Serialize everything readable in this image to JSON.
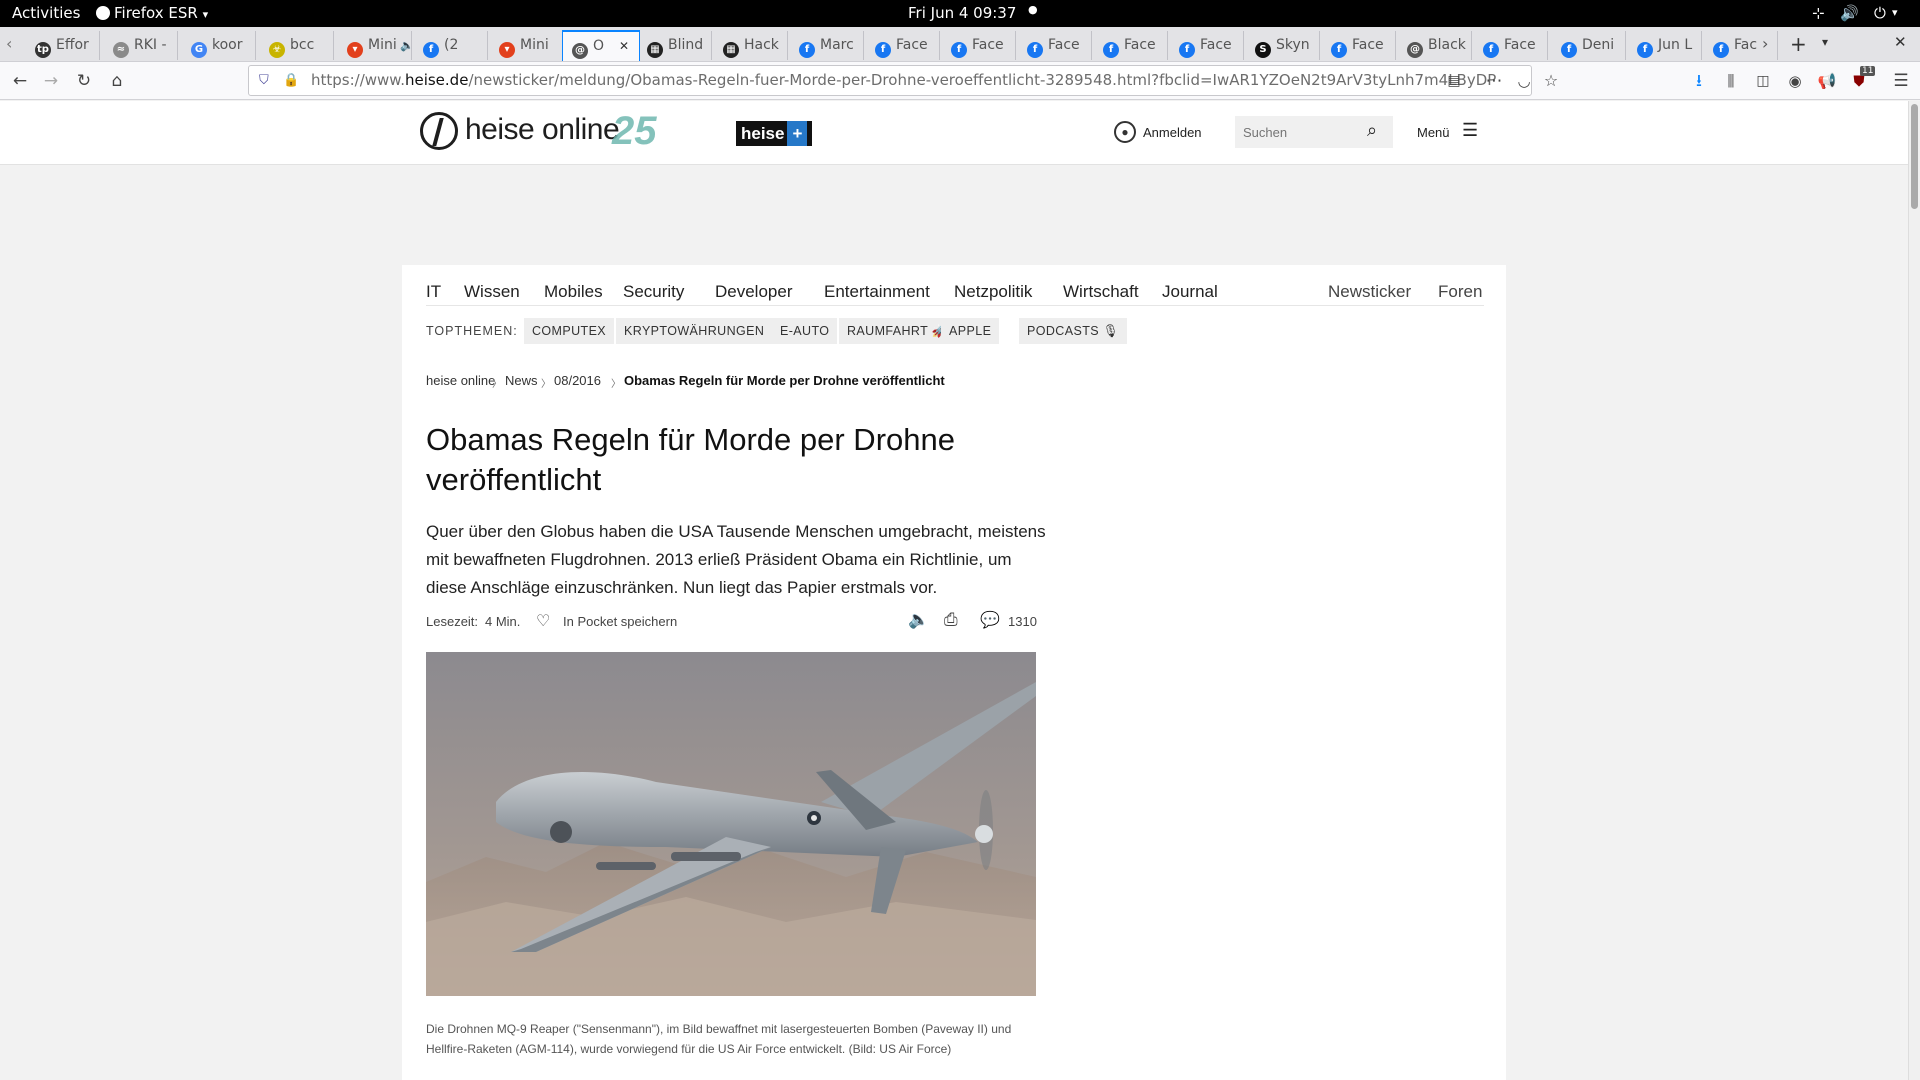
{
  "system_bar": {
    "activities": "Activities",
    "app_name": "Firefox ESR",
    "clock": "Fri Jun 4  09:37"
  },
  "tabs": [
    {
      "label": "Effor",
      "icon_text": "tp",
      "icon_color": "#333333"
    },
    {
      "label": "RKI -",
      "icon_text": "≈",
      "icon_color": "#8a8a8a"
    },
    {
      "label": "koor",
      "icon_text": "G",
      "icon_color": "#4285f4"
    },
    {
      "label": "bcc",
      "icon_text": "☣",
      "icon_color": "#c8b400"
    },
    {
      "label": "Mini",
      "icon_text": "▾",
      "icon_color": "#e2401c"
    },
    {
      "label": "(2",
      "icon_text": "f",
      "icon_color": "#1877f2"
    },
    {
      "label": "Mini",
      "icon_text": "▾",
      "icon_color": "#e2401c"
    },
    {
      "label": "O",
      "icon_text": "@",
      "icon_color": "#555555"
    },
    {
      "label": "Blind",
      "icon_text": "▦",
      "icon_color": "#222222"
    },
    {
      "label": "Hack",
      "icon_text": "▦",
      "icon_color": "#222222"
    },
    {
      "label": "Marc",
      "icon_text": "f",
      "icon_color": "#1877f2"
    },
    {
      "label": "Face",
      "icon_text": "f",
      "icon_color": "#1877f2"
    },
    {
      "label": "Face",
      "icon_text": "f",
      "icon_color": "#1877f2"
    },
    {
      "label": "Face",
      "icon_text": "f",
      "icon_color": "#1877f2"
    },
    {
      "label": "Face",
      "icon_text": "f",
      "icon_color": "#1877f2"
    },
    {
      "label": "Face",
      "icon_text": "f",
      "icon_color": "#1877f2"
    },
    {
      "label": "Skyn",
      "icon_text": "S",
      "icon_color": "#111111"
    },
    {
      "label": "Face",
      "icon_text": "f",
      "icon_color": "#1877f2"
    },
    {
      "label": "Black",
      "icon_text": "@",
      "icon_color": "#555555"
    },
    {
      "label": "Face",
      "icon_text": "f",
      "icon_color": "#1877f2"
    },
    {
      "label": "Deni",
      "icon_text": "f",
      "icon_color": "#1877f2"
    },
    {
      "label": "Jun L",
      "icon_text": "f",
      "icon_color": "#1877f2"
    },
    {
      "label": "Fac",
      "icon_text": "f",
      "icon_color": "#1877f2"
    }
  ],
  "url": {
    "prefix": "https://www.",
    "domain": "heise.de",
    "path": "/newsticker/meldung/Obamas-Regeln-fuer-Morde-per-Drohne-veroeffentlicht-3289548.html?fbclid=IwAR1YZOeN2t9ArV3tyLnh7m4LByDP"
  },
  "addon_badge": "11",
  "site": {
    "logo_text": "heise online",
    "anniversary": "25",
    "plus_label": "heise",
    "login_label": "Anmelden",
    "search_placeholder": "Suchen",
    "menu_label": "Menü"
  },
  "nav": {
    "items": [
      "IT",
      "Wissen",
      "Mobiles",
      "Security",
      "Developer",
      "Entertainment",
      "Netzpolitik",
      "Wirtschaft",
      "Journal"
    ],
    "right": [
      "Newsticker",
      "Foren"
    ]
  },
  "topthemen": {
    "label": "TOPTHEMEN:",
    "items": [
      "COMPUTEX",
      "KRYPTOWÄHRUNGEN",
      "E-AUTO",
      "RAUMFAHRT 🚀",
      "APPLE",
      "PODCASTS 🎙"
    ]
  },
  "breadcrumb": [
    "heise online",
    "News",
    "08/2016",
    "Obamas Regeln für Morde per Drohne veröffentlicht"
  ],
  "article": {
    "headline": "Obamas Regeln für Morde per Drohne veröffentlicht",
    "lead": "Quer über den Globus haben die USA Tausende Menschen umgebracht, meistens mit bewaffneten Flugdrohnen. 2013 erließ Präsident Obama ein Richtlinie, um diese Anschläge einzuschränken. Nun liegt das Papier erstmals vor.",
    "read_time_label": "Lesezeit:",
    "read_time_value": "4 Min.",
    "pocket_label": "In Pocket speichern",
    "comment_count": "1310",
    "caption": "Die Drohnen MQ-9 Reaper (\"Sensenmann\"), im Bild bewaffnet mit lasergesteuerten Bomben (Paveway II) und Hellfire-Raketen (AGM-114), wurde vorwiegend für die US Air Force entwickelt. (Bild: US Air Force)"
  },
  "colors": {
    "accent_blue": "#0a84ff",
    "heise_dark": "#1e1e1e",
    "heise_teal": "#6fb8b0"
  }
}
